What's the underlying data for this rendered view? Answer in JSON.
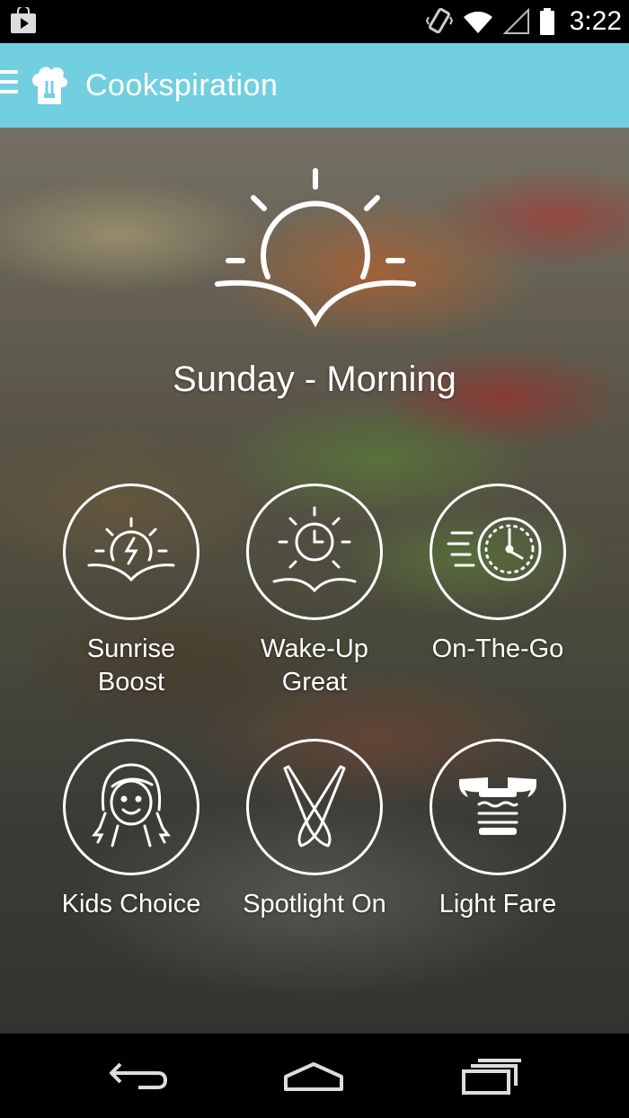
{
  "status_bar": {
    "time": "3:22",
    "icons": [
      "play-store-icon",
      "vibrate-icon",
      "wifi-icon",
      "signal-icon",
      "battery-icon"
    ]
  },
  "app_bar": {
    "title": "Cookspiration",
    "icons": [
      "menu-icon",
      "chef-hat-icon"
    ],
    "color": "#72cfe0"
  },
  "main": {
    "day_title": "Sunday - Morning",
    "hero_icon": "sunrise-icon",
    "tiles": [
      {
        "label": "Sunrise\nBoost",
        "icon": "sunrise-boost-icon"
      },
      {
        "label": "Wake-Up\nGreat",
        "icon": "wake-up-clock-icon"
      },
      {
        "label": "On-The-Go",
        "icon": "fast-clock-icon"
      },
      {
        "label": "Kids Choice",
        "icon": "girl-face-icon"
      },
      {
        "label": "Spotlight On",
        "icon": "crossed-spoons-icon"
      },
      {
        "label": "Light Fare",
        "icon": "winged-burger-icon"
      }
    ]
  },
  "nav_bar": {
    "buttons": [
      "back-icon",
      "home-icon",
      "recents-icon"
    ]
  }
}
